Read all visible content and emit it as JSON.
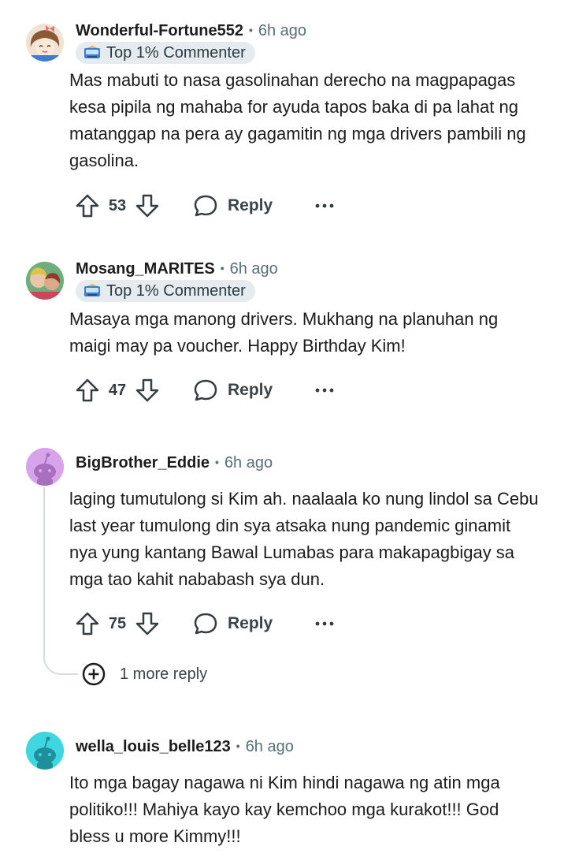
{
  "comments": [
    {
      "username": "Wonderful-Fortune552",
      "time": "6h ago",
      "badge": "Top 1% Commenter",
      "body": "Mas mabuti to nasa gasolinahan derecho na magpapagas kesa pipila ng mahaba for ayuda tapos baka di pa lahat ng matanggap na pera ay gagamitin ng mga drivers pambili ng gasolina.",
      "score": "53",
      "reply_label": "Reply",
      "avatar_icon": "girl-avatar-icon"
    },
    {
      "username": "Mosang_MARITES",
      "time": "6h ago",
      "badge": "Top 1% Commenter",
      "body": "Masaya mga manong drivers. Mukhang na planuhan ng maigi may pa voucher. Happy Birthday Kim!",
      "score": "47",
      "reply_label": "Reply",
      "avatar_icon": "photo-avatar-icon"
    },
    {
      "username": "BigBrother_Eddie",
      "time": "6h ago",
      "body": "laging tumutulong si Kim ah. naalaala ko nung lindol sa Cebu last year tumulong din sya atsaka nung pandemic ginamit nya yung kantang Bawal Lumabas para makapagbigay sa mga tao kahit nababash sya dun.",
      "score": "75",
      "reply_label": "Reply",
      "more_replies": "1 more reply",
      "avatar_icon": "snoo-avatar-icon",
      "avatar_color": "#d7a3ea"
    },
    {
      "username": "wella_louis_belle123",
      "time": "6h ago",
      "body": "Ito mga bagay nagawa ni Kim hindi nagawa ng atin mga politiko!!! Mahiya kayo kay kemchoo mga kurakot!!! God bless u more Kimmy!!!",
      "avatar_icon": "snoo-avatar-icon",
      "avatar_color": "#3ed6e0"
    }
  ],
  "colors": {
    "text": "#1c1c1c",
    "meta": "#576f76",
    "badge_bg": "#e5ebee"
  }
}
